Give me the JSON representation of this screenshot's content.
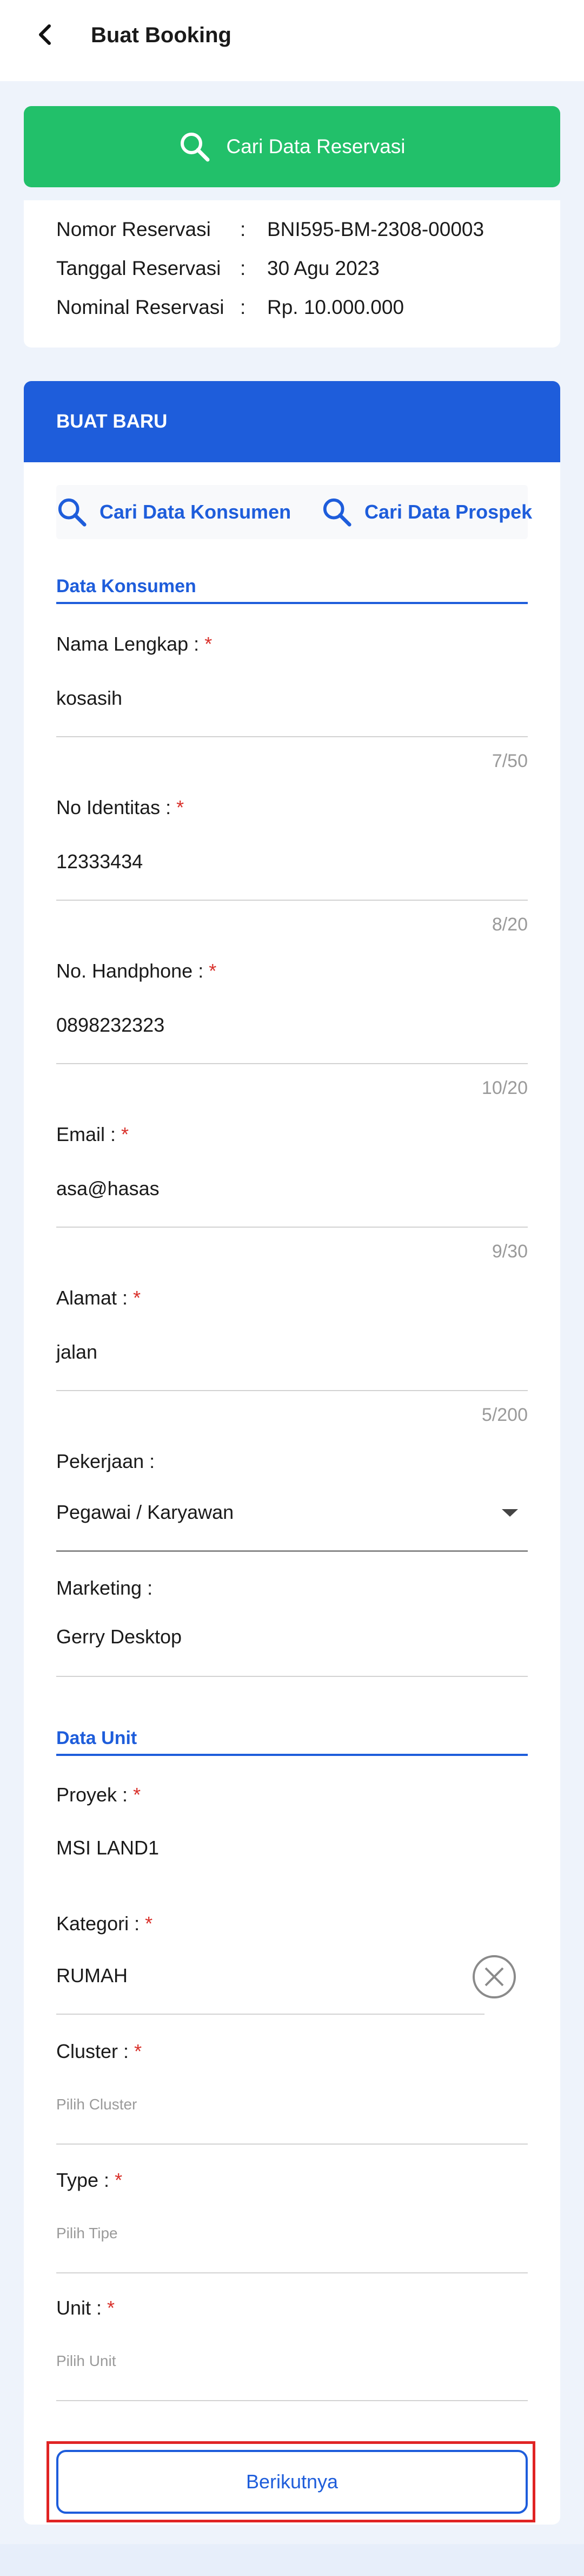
{
  "header": {
    "title": "Buat Booking",
    "back_icon": "chevron-left-icon"
  },
  "search_reservation": {
    "label": "Cari Data Reservasi",
    "icon": "search-icon"
  },
  "reservation": {
    "rows": [
      {
        "label": "Nomor Reservasi",
        "colon": ":",
        "value": "BNI595-BM-2308-00003"
      },
      {
        "label": "Tanggal Reservasi",
        "colon": ":",
        "value": "30 Agu 2023"
      },
      {
        "label": "Nominal Reservasi",
        "colon": ":",
        "value": "Rp. 10.000.000"
      }
    ]
  },
  "form": {
    "header": "BUAT BARU",
    "tools": {
      "consumer": "Cari Data Konsumen",
      "prospect": "Cari Data Prospek"
    },
    "consumer_section": "Data Konsumen",
    "fields": {
      "name": {
        "label": "Nama Lengkap :",
        "required": "*",
        "value": "kosasih",
        "counter": "7/50"
      },
      "id_number": {
        "label": "No Identitas :",
        "required": "*",
        "value": "12333434",
        "counter": "8/20"
      },
      "phone": {
        "label": "No. Handphone :",
        "required": "*",
        "value": "0898232323",
        "counter": "10/20"
      },
      "email": {
        "label": "Email :",
        "required": "*",
        "value": "asa@hasas",
        "counter": "9/30"
      },
      "address": {
        "label": "Alamat :",
        "required": "*",
        "value": "jalan",
        "counter": "5/200"
      },
      "job": {
        "label": "Pekerjaan :",
        "value": "Pegawai / Karyawan"
      },
      "marketing": {
        "label": "Marketing :",
        "value": "Gerry Desktop"
      }
    },
    "unit_section": "Data Unit",
    "unit_fields": {
      "project": {
        "label": "Proyek :",
        "required": "*",
        "value": "MSI LAND1"
      },
      "category": {
        "label": "Kategori :",
        "required": "*",
        "value": "RUMAH"
      },
      "cluster": {
        "label": "Cluster :",
        "required": "*",
        "placeholder": "Pilih Cluster"
      },
      "type": {
        "label": "Type :",
        "required": "*",
        "placeholder": "Pilih Tipe"
      },
      "unit": {
        "label": "Unit :",
        "required": "*",
        "placeholder": "Pilih Unit"
      }
    },
    "next_label": "Berikutnya"
  },
  "colors": {
    "green": "#22c06a",
    "blue": "#1e5ddb",
    "required": "#d9312b",
    "highlight": "#e02424"
  }
}
